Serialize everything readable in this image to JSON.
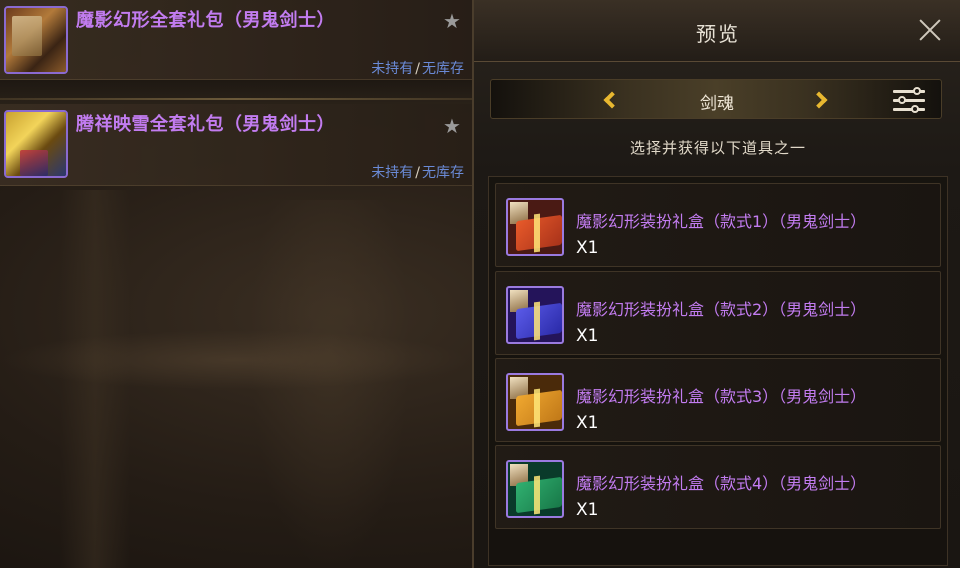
{
  "left_list": {
    "items": [
      {
        "title": "魔影幻形全套礼包（男鬼剑士）",
        "status_owned": "未持有",
        "status_sep": "/",
        "status_stock": "无库存",
        "icon": "costume-pack-icon"
      },
      {
        "title": "腾祥映雪全套礼包（男鬼剑士）",
        "status_owned": "未持有",
        "status_sep": "/",
        "status_stock": "无库存",
        "icon": "costume-pack-icon"
      }
    ]
  },
  "preview": {
    "title": "预览",
    "class_selector": {
      "current": "剑魂"
    },
    "instruction": "选择并获得以下道具之一",
    "rewards": [
      {
        "name": "魔影幻形装扮礼盒（款式1）（男鬼剑士）",
        "qty": "X1",
        "color": "#e85a2a"
      },
      {
        "name": "魔影幻形装扮礼盒（款式2）（男鬼剑士）",
        "qty": "X1",
        "color": "#5a5ae8"
      },
      {
        "name": "魔影幻形装扮礼盒（款式3）（男鬼剑士）",
        "qty": "X1",
        "color": "#f0a830"
      },
      {
        "name": "魔影幻形装扮礼盒（款式4）（男鬼剑士）",
        "qty": "X1",
        "color": "#30b070"
      }
    ]
  },
  "colors": {
    "item_name": "#c27cf0",
    "status": "#6a8ad6",
    "arrow": "#e8b830"
  }
}
